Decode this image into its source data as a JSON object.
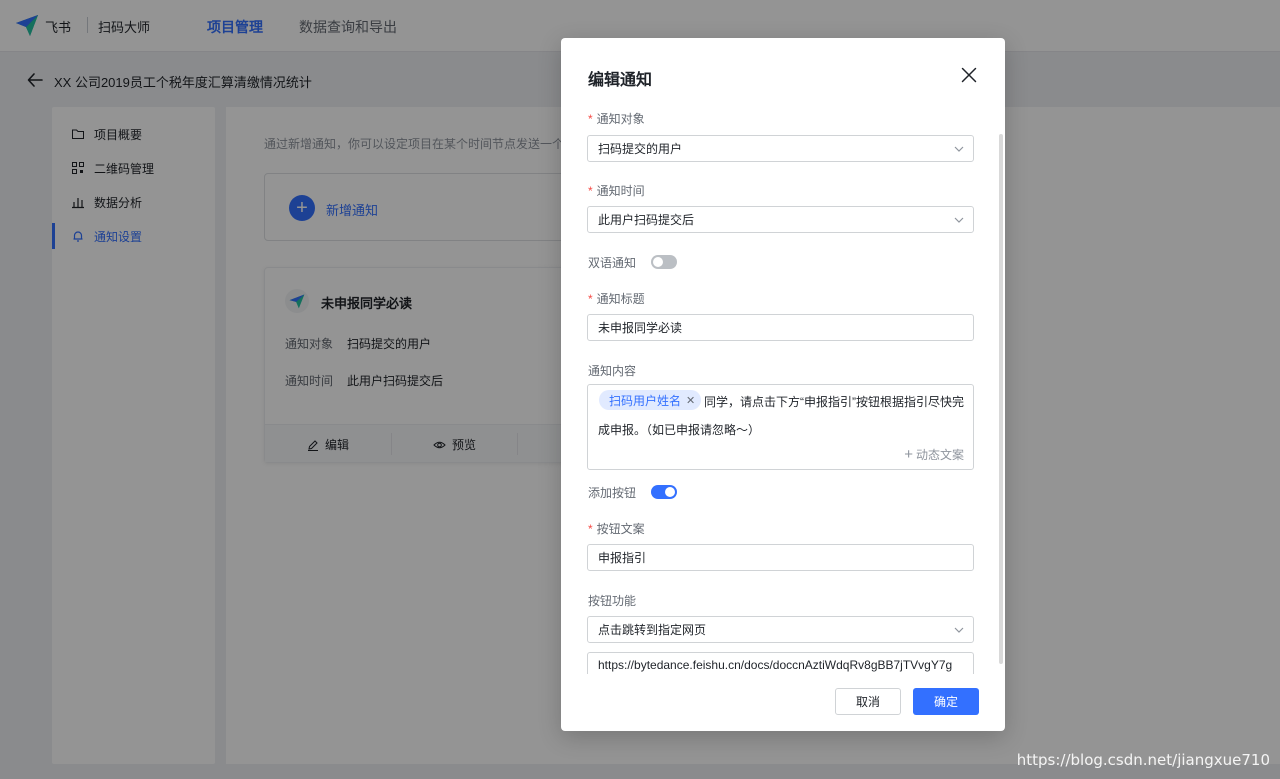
{
  "topbar": {
    "brand": "飞书",
    "app_name": "扫码大师",
    "nav": [
      "项目管理",
      "数据查询和导出"
    ]
  },
  "page": {
    "title": "XX 公司2019员工个税年度汇算清缴情况统计"
  },
  "sidebar": {
    "items": [
      {
        "label": "项目概要",
        "icon": "folder-icon"
      },
      {
        "label": "二维码管理",
        "icon": "qrcode-icon"
      },
      {
        "label": "数据分析",
        "icon": "bar-chart-icon"
      },
      {
        "label": "通知设置",
        "icon": "bell-icon"
      }
    ]
  },
  "main": {
    "hint": "通过新增通知，你可以设定项目在某个时间节点发送一个飞",
    "add_label": "新增通知",
    "card": {
      "title": "未申报同学必读",
      "target_label": "通知对象",
      "target_value": "扫码提交的用户",
      "time_label": "通知时间",
      "time_value": "此用户扫码提交后",
      "actions": [
        "编辑",
        "预览"
      ]
    }
  },
  "dialog": {
    "title": "编辑通知",
    "target": {
      "label": "通知对象",
      "value": "扫码提交的用户"
    },
    "time": {
      "label": "通知时间",
      "value": "此用户扫码提交后"
    },
    "bilingual": {
      "label": "双语通知",
      "on": false
    },
    "notice_title": {
      "label": "通知标题",
      "value": "未申报同学必读"
    },
    "content": {
      "label": "通知内容",
      "tag": "扫码用户姓名",
      "line1": "同学，请点击下方“申报指引”按钮根据指引尽快完",
      "line2": "成申报。（如已申报请忽略～）",
      "dynamic_copy": "动态文案"
    },
    "add_button": {
      "label": "添加按钮",
      "on": true
    },
    "button_text": {
      "label": "按钮文案",
      "value": "申报指引"
    },
    "button_function": {
      "label": "按钮功能",
      "value": "点击跳转到指定网页"
    },
    "url": "https://bytedance.feishu.cn/docs/doccnAztiWdqRv8gBB7jTVvgY7g",
    "cancel": "取消",
    "confirm": "确定"
  },
  "watermark": "https://blog.csdn.net/jiangxue710",
  "colors": {
    "accent": "#3370ff",
    "required": "#f54a45"
  }
}
